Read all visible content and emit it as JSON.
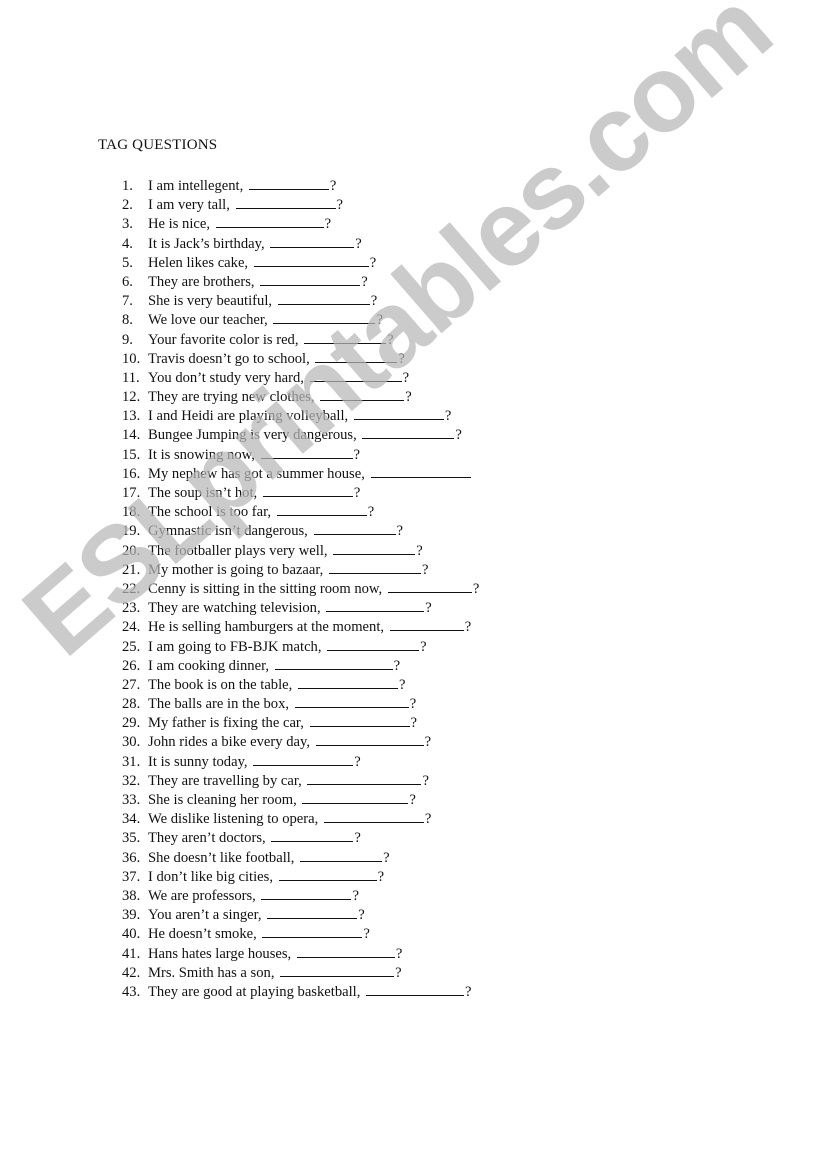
{
  "document": {
    "title": "TAG QUESTIONS",
    "watermark": "ESLprintables.com",
    "questions": [
      {
        "num": "1.",
        "text": "I am intellegent,",
        "blank": 80,
        "qmark": "?"
      },
      {
        "num": "2.",
        "text": "I am very tall,",
        "blank": 100,
        "qmark": "?"
      },
      {
        "num": "3.",
        "text": "He is nice,",
        "blank": 108,
        "qmark": "?"
      },
      {
        "num": "4.",
        "text": "It is Jack’s birthday,",
        "blank": 84,
        "qmark": "?"
      },
      {
        "num": "5.",
        "text": "Helen likes cake,",
        "blank": 115,
        "qmark": "?"
      },
      {
        "num": "6.",
        "text": "They are brothers,",
        "blank": 100,
        "qmark": "?"
      },
      {
        "num": "7.",
        "text": "She is very beautiful,",
        "blank": 92,
        "qmark": "?"
      },
      {
        "num": "8.",
        "text": "We love our teacher,",
        "blank": 102,
        "qmark": "?"
      },
      {
        "num": "9.",
        "text": "Your favorite color is red,",
        "blank": 82,
        "qmark": "?"
      },
      {
        "num": "10.",
        "text": "Travis doesn’t go to school,",
        "blank": 82,
        "qmark": "?"
      },
      {
        "num": "11.",
        "text": "You don’t study very hard,",
        "blank": 92,
        "qmark": "?"
      },
      {
        "num": "12.",
        "text": "They are trying new clothes,",
        "blank": 84,
        "qmark": "?"
      },
      {
        "num": "13.",
        "text": "I and Heidi are playing volleyball,",
        "blank": 90,
        "qmark": "?"
      },
      {
        "num": "14.",
        "text": "Bungee Jumping is very dangerous,",
        "blank": 92,
        "qmark": "?"
      },
      {
        "num": "15.",
        "text": "It is snowing now,",
        "blank": 92,
        "qmark": "?"
      },
      {
        "num": "16.",
        "text": "My nephew has got a summer house,",
        "blank": 100,
        "qmark": ""
      },
      {
        "num": "17.",
        "text": "The soup isn’t hot,",
        "blank": 90,
        "qmark": "?"
      },
      {
        "num": "18.",
        "text": "The school is too far,",
        "blank": 90,
        "qmark": "?"
      },
      {
        "num": "19.",
        "text": "Gymnastic isn’t dangerous,",
        "blank": 82,
        "qmark": "?"
      },
      {
        "num": "20.",
        "text": "The footballer plays very well,",
        "blank": 82,
        "qmark": "?"
      },
      {
        "num": "21.",
        "text": "My mother is going to bazaar,",
        "blank": 92,
        "qmark": "?"
      },
      {
        "num": "22.",
        "text": "Cenny is sitting in the sitting room now,",
        "blank": 84,
        "qmark": "?"
      },
      {
        "num": "23.",
        "text": "They are watching television,",
        "blank": 98,
        "qmark": "?"
      },
      {
        "num": "24.",
        "text": "He is selling hamburgers at the moment,",
        "blank": 74,
        "qmark": "?"
      },
      {
        "num": "25.",
        "text": "I am going to FB-BJK match,",
        "blank": 92,
        "qmark": "?"
      },
      {
        "num": "26.",
        "text": "I am cooking dinner,",
        "blank": 118,
        "qmark": "?"
      },
      {
        "num": "27.",
        "text": "The book is on the table,",
        "blank": 100,
        "qmark": "?"
      },
      {
        "num": "28.",
        "text": "The balls are in the box,",
        "blank": 114,
        "qmark": "?"
      },
      {
        "num": "29.",
        "text": "My father is fixing the car,",
        "blank": 100,
        "qmark": "?"
      },
      {
        "num": "30.",
        "text": "John rides a bike every day,",
        "blank": 108,
        "qmark": "?"
      },
      {
        "num": "31.",
        "text": "It is sunny today,",
        "blank": 100,
        "qmark": "?"
      },
      {
        "num": "32.",
        "text": "They are travelling by car,",
        "blank": 114,
        "qmark": "?"
      },
      {
        "num": "33.",
        "text": "She is cleaning her room,",
        "blank": 106,
        "qmark": "?"
      },
      {
        "num": "34.",
        "text": "We dislike listening to opera,",
        "blank": 100,
        "qmark": "?"
      },
      {
        "num": "35.",
        "text": "They aren’t doctors,",
        "blank": 82,
        "qmark": "?"
      },
      {
        "num": "36.",
        "text": "She doesn’t like football,",
        "blank": 82,
        "qmark": "?"
      },
      {
        "num": "37.",
        "text": "I don’t like big cities,",
        "blank": 98,
        "qmark": "?"
      },
      {
        "num": "38.",
        "text": "We are professors,",
        "blank": 90,
        "qmark": "?"
      },
      {
        "num": "39.",
        "text": "You aren’t a singer,",
        "blank": 90,
        "qmark": "?"
      },
      {
        "num": "40.",
        "text": "He doesn’t smoke,",
        "blank": 100,
        "qmark": "?"
      },
      {
        "num": "41.",
        "text": "Hans hates large houses,",
        "blank": 98,
        "qmark": "?"
      },
      {
        "num": "42.",
        "text": "Mrs. Smith has a son,",
        "blank": 114,
        "qmark": "?"
      },
      {
        "num": "43.",
        "text": "They are good at playing basketball,",
        "blank": 98,
        "qmark": "?"
      }
    ]
  }
}
